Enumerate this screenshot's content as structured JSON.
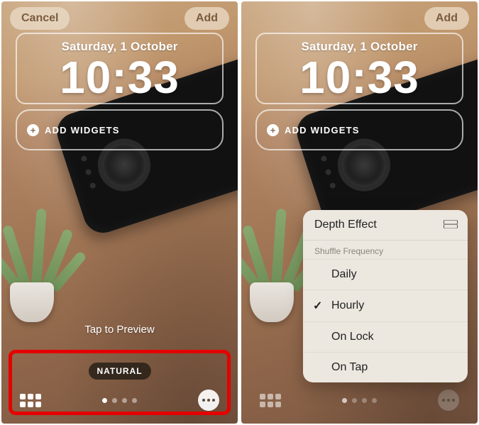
{
  "left": {
    "topbar": {
      "cancel": "Cancel",
      "add": "Add"
    },
    "date": "Saturday, 1 October",
    "time": "10:33",
    "add_widgets": "ADD WIDGETS",
    "tap_preview": "Tap to Preview",
    "style_label": "NATURAL"
  },
  "right": {
    "topbar": {
      "add": "Add"
    },
    "date": "Saturday, 1 October",
    "time": "10:33",
    "add_widgets": "ADD WIDGETS",
    "popup": {
      "depth_effect": "Depth Effect",
      "section": "Shuffle Frequency",
      "options": [
        "Daily",
        "Hourly",
        "On Lock",
        "On Tap"
      ],
      "selected_index": 1
    }
  }
}
